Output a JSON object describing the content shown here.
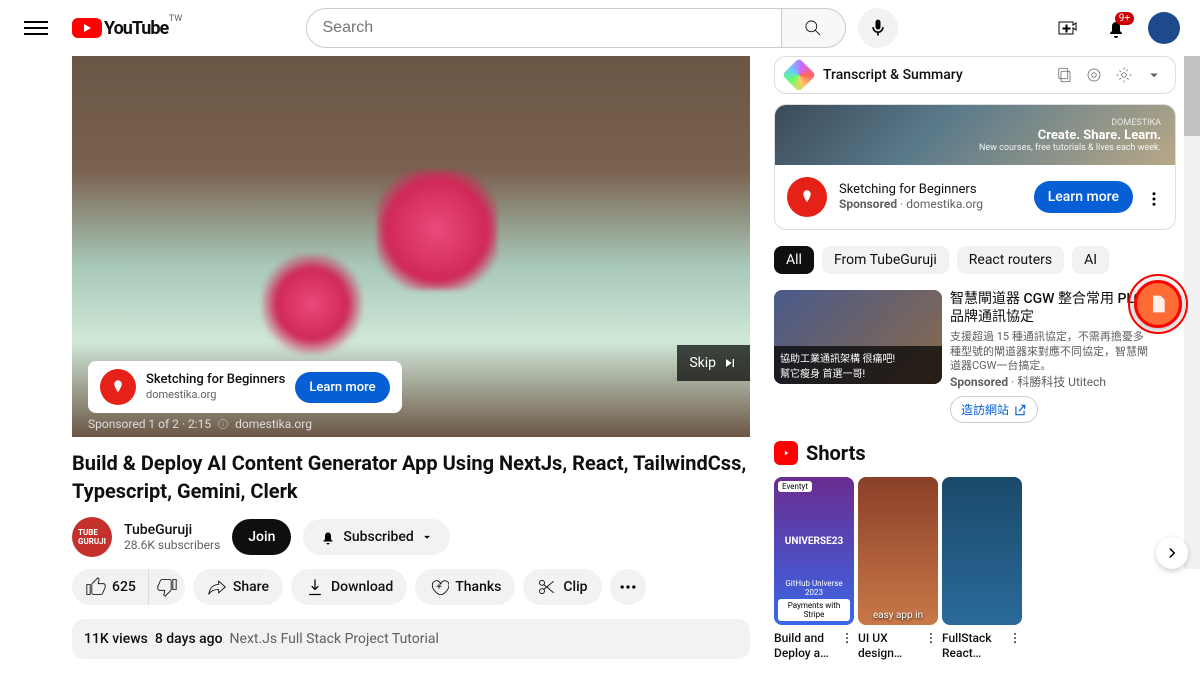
{
  "header": {
    "logo_text": "YouTube",
    "region": "TW",
    "search_placeholder": "Search",
    "notif_count": "9+"
  },
  "player": {
    "skip_label": "Skip",
    "ad_info": "Sponsored 1 of 2 · 2:15",
    "ad_domain": "domestika.org",
    "overlay_title": "Sketching for Beginners",
    "overlay_domain": "domestika.org",
    "overlay_cta": "Learn more"
  },
  "video": {
    "title": "Build & Deploy AI Content Generator App Using NextJs, React, TailwindCss, Typescript, Gemini, Clerk",
    "channel_name": "TubeGuruji",
    "channel_subs": "28.6K subscribers",
    "join_label": "Join",
    "subscribed_label": "Subscribed",
    "likes": "625",
    "share_label": "Share",
    "download_label": "Download",
    "thanks_label": "Thanks",
    "clip_label": "Clip",
    "views": "11K views",
    "age": "8 days ago",
    "desc_part": "Next.Js Full Stack Project Tutorial"
  },
  "transcript": {
    "title": "Transcript & Summary"
  },
  "sponsor": {
    "banner_tag": "DOMESTIKA",
    "banner_title": "Create. Share. Learn.",
    "banner_sub": "New courses, free tutorials & lives each week.",
    "title": "Sketching for Beginners",
    "sponsored_label": "Sponsored",
    "domain": "domestika.org",
    "cta": "Learn more"
  },
  "chips": [
    "All",
    "From TubeGuruji",
    "React routers",
    "AI"
  ],
  "related_ad": {
    "title": "智慧閘道器 CGW 整合常用 PLC 品牌通訊協定",
    "desc": "支援超過 15 種通訊協定，不需再擔憂多種型號的閘道器來對應不同協定，智慧閘道器CGW一台搞定。",
    "sponsored": "Sponsored",
    "advertiser": "科勝科技 Utitech",
    "thumb_label1": "協助工業通訊架構 很痛吧!",
    "thumb_label2": "幫它瘦身 首選一哥!",
    "visit_label": "造訪網站"
  },
  "shorts": {
    "heading": "Shorts",
    "items": [
      {
        "overlay_top": "Eventyt",
        "overlay_mid": "UNIVERSE23",
        "overlay_bot": "GitHub Universe 2023",
        "pill": "Payments with Stripe",
        "title": "Build and Deploy a Full Stack Ne..."
      },
      {
        "overlay_bot": "easy app in",
        "title": "UI UX design Figma tutorial..."
      },
      {
        "title": "FullStack React Tailwindcss Hu..."
      }
    ]
  }
}
